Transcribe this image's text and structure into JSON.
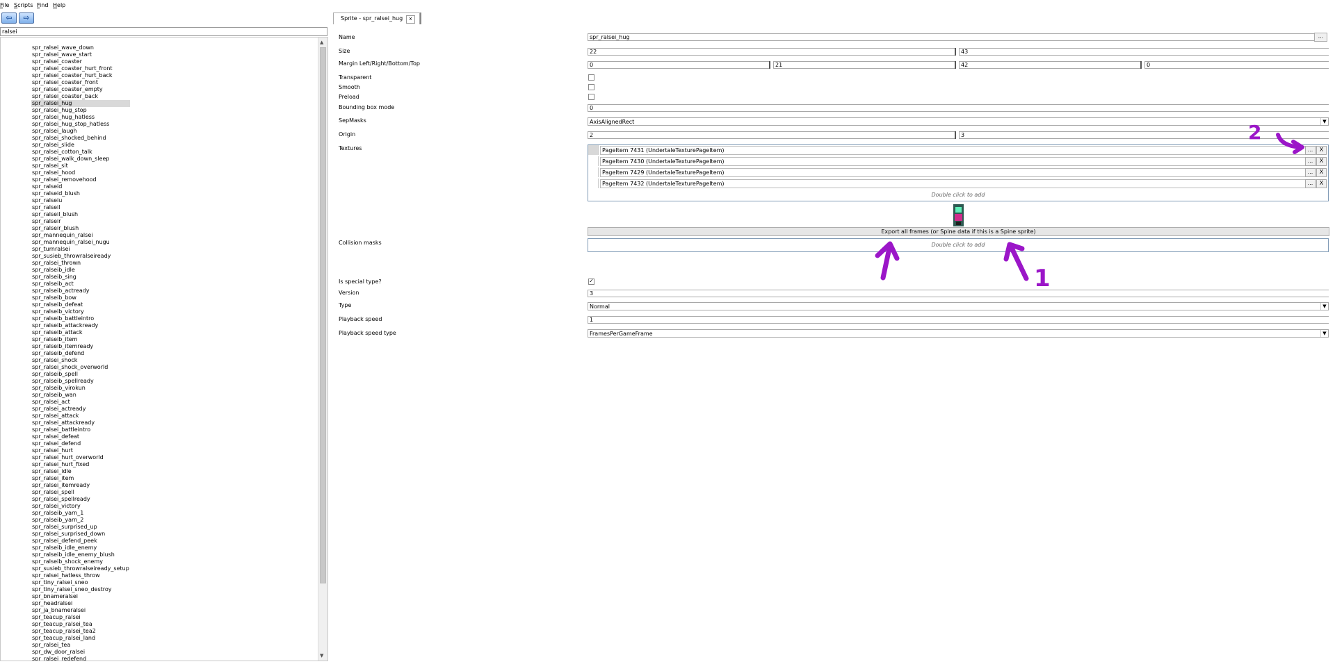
{
  "menu": [
    "File",
    "Scripts",
    "Find",
    "Help"
  ],
  "nav": {
    "back_icon": "arrow-left-icon",
    "forward_icon": "arrow-right-icon",
    "back_glyph": "⇦",
    "forward_glyph": "⇨"
  },
  "search": {
    "value": "ralsei"
  },
  "tree": {
    "selected": "spr_ralsei_hug",
    "items": [
      "spr_ralsei_wave_down",
      "spr_ralsei_wave_start",
      "spr_ralsei_coaster",
      "spr_ralsei_coaster_hurt_front",
      "spr_ralsei_coaster_hurt_back",
      "spr_ralsei_coaster_front",
      "spr_ralsei_coaster_empty",
      "spr_ralsei_coaster_back",
      "spr_ralsei_hug",
      "spr_ralsei_hug_stop",
      "spr_ralsei_hug_hatless",
      "spr_ralsei_hug_stop_hatless",
      "spr_ralsei_laugh",
      "spr_ralsei_shocked_behind",
      "spr_ralsei_slide",
      "spr_ralsei_cotton_talk",
      "spr_ralsei_walk_down_sleep",
      "spr_ralsei_sit",
      "spr_ralsei_hood",
      "spr_ralsei_removehood",
      "spr_ralseid",
      "spr_ralseid_blush",
      "spr_ralseiu",
      "spr_ralseil",
      "spr_ralseil_blush",
      "spr_ralseir",
      "spr_ralseir_blush",
      "spr_mannequin_ralsei",
      "spr_mannequin_ralsei_nugu",
      "spr_turnralsei",
      "spr_susieb_throwralseiready",
      "spr_ralsei_thrown",
      "spr_ralseib_idle",
      "spr_ralseib_sing",
      "spr_ralseib_act",
      "spr_ralseib_actready",
      "spr_ralseib_bow",
      "spr_ralseib_defeat",
      "spr_ralseib_victory",
      "spr_ralseib_battleintro",
      "spr_ralseib_attackready",
      "spr_ralseib_attack",
      "spr_ralseib_item",
      "spr_ralseib_itemready",
      "spr_ralseib_defend",
      "spr_ralsei_shock",
      "spr_ralsei_shock_overworld",
      "spr_ralseib_spell",
      "spr_ralseib_spellready",
      "spr_ralseib_virokun",
      "spr_ralseib_wan",
      "spr_ralsei_act",
      "spr_ralsei_actready",
      "spr_ralsei_attack",
      "spr_ralsei_attackready",
      "spr_ralsei_battleintro",
      "spr_ralsei_defeat",
      "spr_ralsei_defend",
      "spr_ralsei_hurt",
      "spr_ralsei_hurt_overworld",
      "spr_ralsei_hurt_fixed",
      "spr_ralsei_idle",
      "spr_ralsei_item",
      "spr_ralsei_itemready",
      "spr_ralsei_spell",
      "spr_ralsei_spellready",
      "spr_ralsei_victory",
      "spr_ralseib_yarn_1",
      "spr_ralseib_yarn_2",
      "spr_ralsei_surprised_up",
      "spr_ralsei_surprised_down",
      "spr_ralsei_defend_peek",
      "spr_ralseib_idle_enemy",
      "spr_ralseib_idle_enemy_blush",
      "spr_ralseib_shock_enemy",
      "spr_susieb_throwralseiready_setup",
      "spr_ralsei_hatless_throw",
      "spr_tiny_ralsei_sneo",
      "spr_tiny_ralsei_sneo_destroy",
      "spr_bnameralsei",
      "spr_headralsei",
      "spr_ja_bnameralsei",
      "spr_teacup_ralsei",
      "spr_teacup_ralsei_tea",
      "spr_teacup_ralsei_tea2",
      "spr_teacup_ralsei_land",
      "spr_ralsei_tea",
      "spr_dw_door_ralsei",
      "spr_ralsei_redefend"
    ]
  },
  "tab": {
    "title": "Sprite - spr_ralsei_hug",
    "close": "x"
  },
  "props": {
    "labels": {
      "name": "Name",
      "size": "Size",
      "margin": "Margin Left/Right/Bottom/Top",
      "transparent": "Transparent",
      "smooth": "Smooth",
      "preload": "Preload",
      "bbox_mode": "Bounding box mode",
      "sepmasks": "SepMasks",
      "origin": "Origin",
      "textures": "Textures",
      "collision": "Collision masks",
      "special": "Is special type?",
      "version": "Version",
      "type": "Type",
      "playback_speed": "Playback speed",
      "playback_type": "Playback speed type"
    },
    "name": "spr_ralsei_hug",
    "browse": "...",
    "size_w": "22",
    "size_h": "43",
    "margin_left": "0",
    "margin_right": "21",
    "margin_bottom": "42",
    "margin_top": "0",
    "transparent": false,
    "smooth": false,
    "preload": false,
    "bbox_mode": "0",
    "sepmasks": "AxisAlignedRect",
    "origin_x": "2",
    "origin_y": "3",
    "is_special": true,
    "special_mark": "✓",
    "version": "3",
    "type": "Normal",
    "playback_speed": "1",
    "playback_type": "FramesPerGameFrame",
    "dropdown_arrow": "▼"
  },
  "textures": [
    {
      "label": "PageItem 7431 (UndertaleTexturePageItem)",
      "browse": "...",
      "remove": "X"
    },
    {
      "label": "PageItem 7430 (UndertaleTexturePageItem)",
      "browse": "...",
      "remove": "X"
    },
    {
      "label": "PageItem 7429 (UndertaleTexturePageItem)",
      "browse": "...",
      "remove": "X"
    },
    {
      "label": "PageItem 7432 (UndertaleTexturePageItem)",
      "browse": "...",
      "remove": "X"
    }
  ],
  "add_hint": "Double click to add",
  "export_label": "Export all frames (or Spine data if this is a Spine sprite)",
  "annotations": {
    "color": "#9b16c8",
    "label_1": "1",
    "label_2": "2"
  },
  "colors": {
    "accent": "#7fb0ea",
    "selection": "#d9d9d9",
    "annotation": "#9b16c8"
  }
}
